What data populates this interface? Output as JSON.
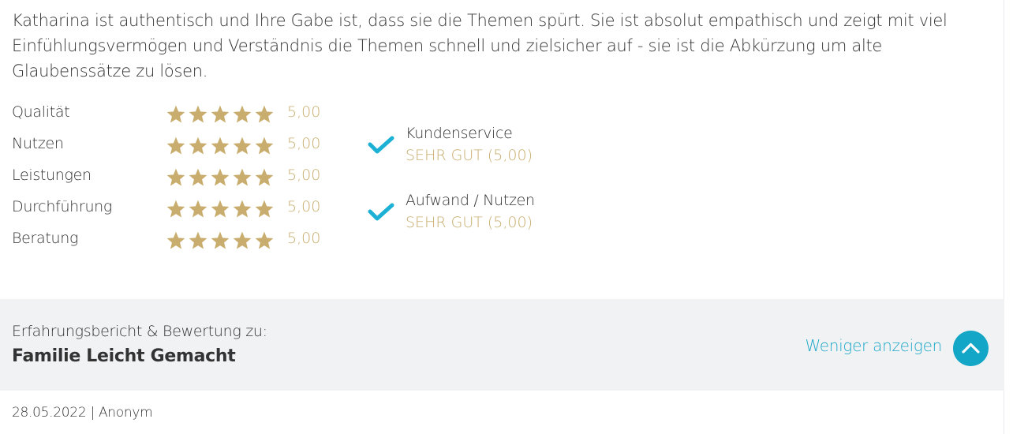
{
  "review": {
    "text": "Katharina ist authentisch und Ihre Gabe ist, dass sie die Themen spürt. Sie ist absolut empathisch und zeigt mit viel Einfühlungsvermögen und Verständnis die Themen schnell und zielsicher auf - sie ist die Abkürzung um alte Glaubenssätze zu lösen."
  },
  "ratings": [
    {
      "label": "Qualität",
      "value": "5,00",
      "stars": 5
    },
    {
      "label": "Nutzen",
      "value": "5,00",
      "stars": 5
    },
    {
      "label": "Leistungen",
      "value": "5,00",
      "stars": 5
    },
    {
      "label": "Durchführung",
      "value": "5,00",
      "stars": 5
    },
    {
      "label": "Beratung",
      "value": "5,00",
      "stars": 5
    }
  ],
  "summary": [
    {
      "title": "Kundenservice",
      "grade": "SEHR GUT (5,00)",
      "icon": "checkmark-icon"
    },
    {
      "title": "Aufwand / Nutzen",
      "grade": "SEHR GUT (5,00)",
      "icon": "checkmark-icon"
    }
  ],
  "footer": {
    "label": "Erfahrungsbericht & Bewertung zu:",
    "company": "Familie Leicht Gemacht",
    "toggle_label": "Weniger anzeigen",
    "toggle_icon": "chevron-up-icon"
  },
  "meta": {
    "line": "28.05.2022 | Anonym"
  },
  "colors": {
    "accent": "#13a6c6",
    "gold": "#c8ad6e",
    "check": "#1cb0d4",
    "band": "#f1f2f4",
    "text": "#333333"
  }
}
